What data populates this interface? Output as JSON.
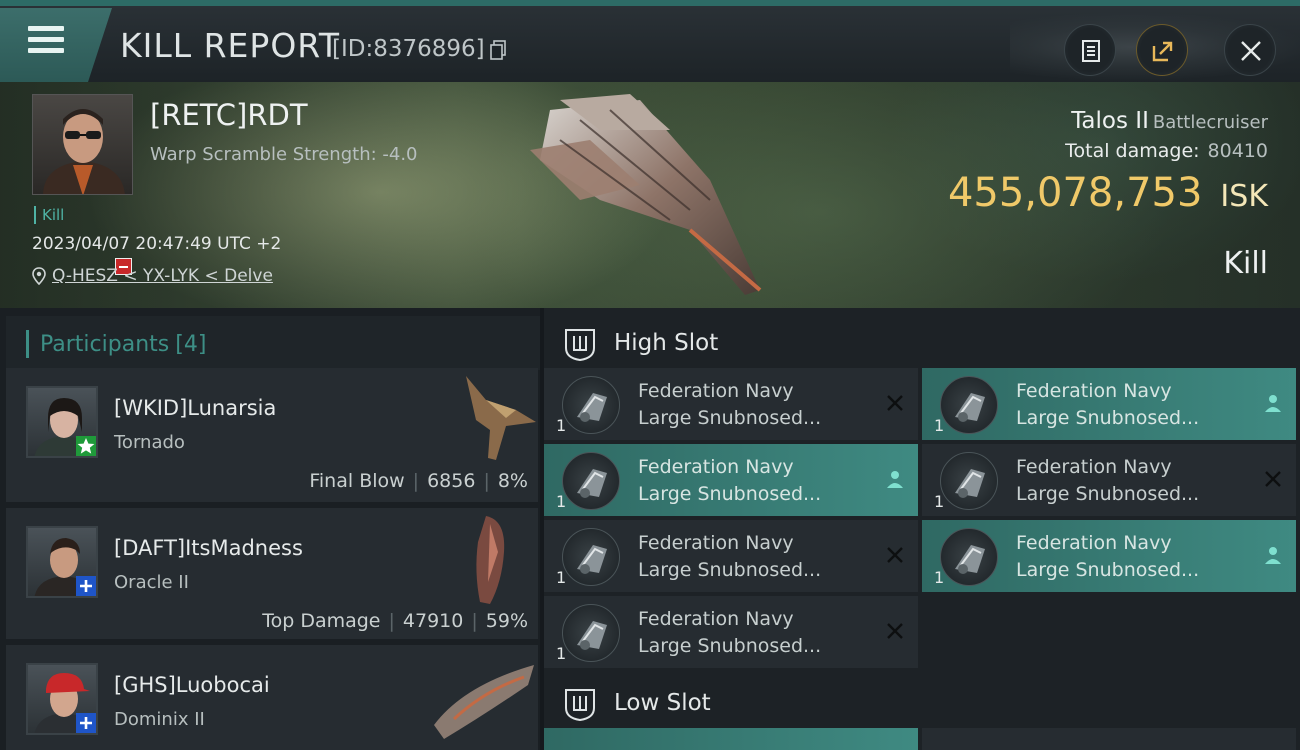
{
  "header": {
    "title": "KILL REPORT",
    "report_id": "[ID:8376896]"
  },
  "victim": {
    "name": "[RETC]RDT",
    "warp_scramble": "Warp Scramble Strength: -4.0",
    "kill_tag": "Kill",
    "datetime": "2023/04/07 20:47:49 UTC +2",
    "location": "Q-HESZ < YX-LYK < Delve",
    "ship_name": "Talos II",
    "ship_class": "Battlecruiser",
    "total_damage_label": "Total damage:",
    "total_damage": "80410",
    "isk_value": "455,078,753",
    "isk_unit": "ISK",
    "result": "Kill"
  },
  "participants": {
    "label": "Participants",
    "count": "[4]",
    "items": [
      {
        "name": "[WKID]Lunarsia",
        "ship": "Tornado",
        "role": "Final Blow",
        "damage": "6856",
        "percent": "8%",
        "badge": "star"
      },
      {
        "name": "[DAFT]ItsMadness",
        "ship": "Oracle II",
        "role": "Top Damage",
        "damage": "47910",
        "percent": "59%",
        "badge": "plus"
      },
      {
        "name": "[GHS]Luobocai",
        "ship": "Dominix II",
        "role": "",
        "damage": "",
        "percent": "",
        "badge": "plus"
      }
    ]
  },
  "slots": {
    "high_label": "High Slot",
    "low_label": "Low Slot",
    "high_modules": [
      {
        "line1": "Federation Navy",
        "line2": "Large Snubnosed...",
        "qty": "1",
        "status": "destroyed"
      },
      {
        "line1": "Federation Navy",
        "line2": "Large Snubnosed...",
        "qty": "1",
        "status": "dropped"
      },
      {
        "line1": "Federation Navy",
        "line2": "Large Snubnosed...",
        "qty": "1",
        "status": "dropped"
      },
      {
        "line1": "Federation Navy",
        "line2": "Large Snubnosed...",
        "qty": "1",
        "status": "destroyed"
      },
      {
        "line1": "Federation Navy",
        "line2": "Large Snubnosed...",
        "qty": "1",
        "status": "destroyed"
      },
      {
        "line1": "Federation Navy",
        "line2": "Large Snubnosed...",
        "qty": "1",
        "status": "dropped"
      },
      {
        "line1": "Federation Navy",
        "line2": "Large Snubnosed...",
        "qty": "1",
        "status": "destroyed"
      }
    ]
  },
  "colors": {
    "accent": "#3d8f86",
    "isk": "#f0c969",
    "highlight": "#3f8a82"
  },
  "icons": [
    "menu-icon",
    "copy-icon",
    "clipboard-icon",
    "share-icon",
    "close-icon",
    "location-pin-icon",
    "slot-icon",
    "destroyed-x-icon",
    "dropped-person-icon"
  ]
}
